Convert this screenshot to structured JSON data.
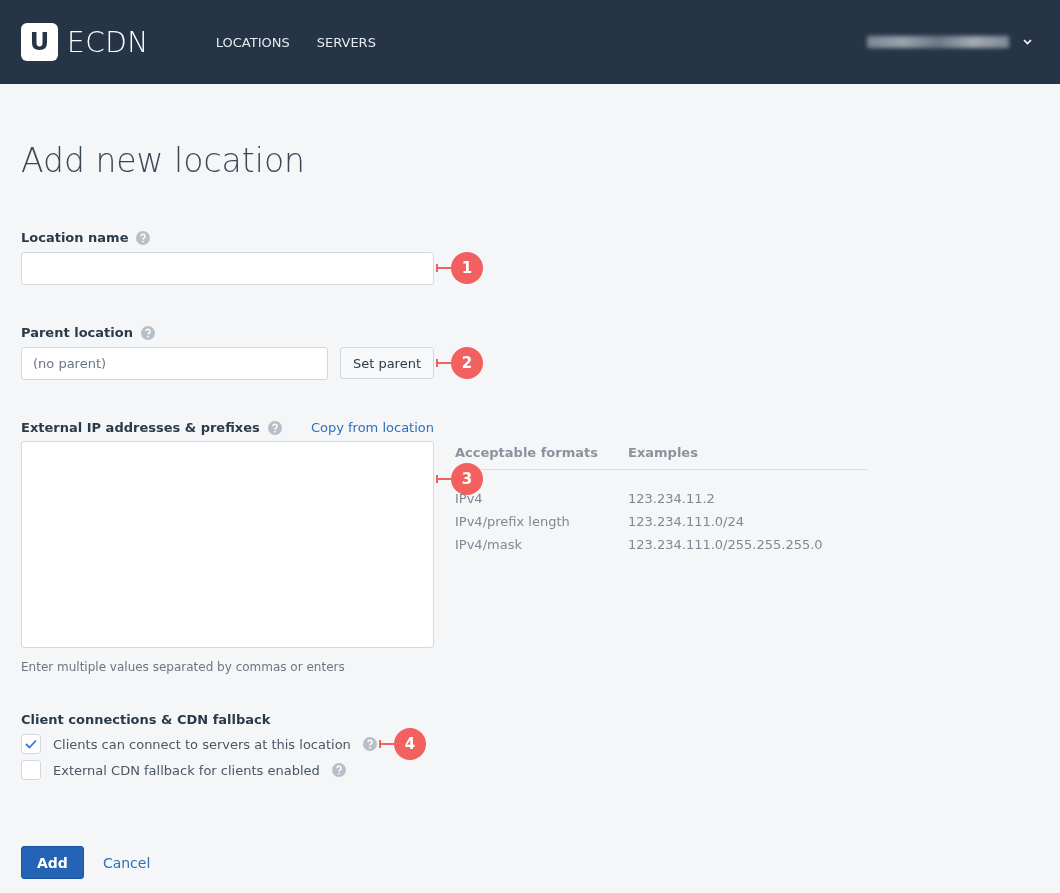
{
  "header": {
    "logo_letter": "U",
    "brand": "ECDN",
    "nav": [
      {
        "label": "LOCATIONS"
      },
      {
        "label": "SERVERS"
      }
    ]
  },
  "page_title": "Add new location",
  "location_name": {
    "label": "Location name",
    "callout": "1"
  },
  "parent_location": {
    "label": "Parent location",
    "placeholder": "(no parent)",
    "button": "Set parent",
    "callout": "2"
  },
  "ip_addresses": {
    "label": "External IP addresses & prefixes",
    "link": "Copy from location",
    "hint": "Enter multiple values separated by commas or enters",
    "callout": "3",
    "formats_table": {
      "columns": [
        "Acceptable formats",
        "Examples"
      ],
      "rows": [
        {
          "format": "IPv4",
          "example": "123.234.11.2"
        },
        {
          "format": "IPv4/prefix length",
          "example": "123.234.111.0/24"
        },
        {
          "format": "IPv4/mask",
          "example": "123.234.111.0/255.255.255.0"
        }
      ]
    }
  },
  "client_connections": {
    "label": "Client connections & CDN fallback",
    "callout": "4",
    "options": [
      {
        "label": "Clients can connect to servers at this location",
        "checked": true
      },
      {
        "label": "External CDN fallback for clients enabled",
        "checked": false
      }
    ]
  },
  "buttons": {
    "primary": "Add",
    "cancel": "Cancel"
  }
}
